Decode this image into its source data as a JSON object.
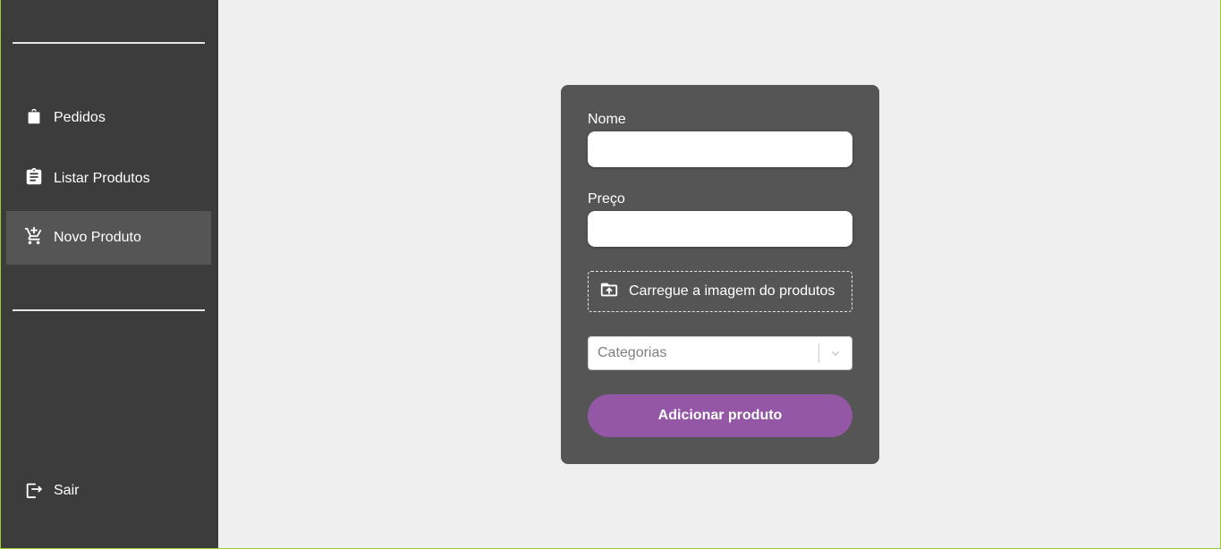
{
  "sidebar": {
    "items": [
      {
        "label": "Pedidos",
        "icon": "shopping-bag-icon"
      },
      {
        "label": "Listar Produtos",
        "icon": "clipboard-list-icon"
      },
      {
        "label": "Novo Produto",
        "icon": "cart-add-icon",
        "active": true
      }
    ],
    "logout": {
      "label": "Sair",
      "icon": "logout-icon"
    }
  },
  "form": {
    "name_label": "Nome",
    "name_value": "",
    "price_label": "Preço",
    "price_value": "",
    "upload_label": "Carregue a imagem do produtos",
    "category_placeholder": "Categorias",
    "submit_label": "Adicionar produto"
  },
  "colors": {
    "sidebar_bg": "#3c3c3c",
    "active_item_bg": "#555555",
    "card_bg": "#555555",
    "page_bg": "#efefef",
    "accent": "#9457a6"
  }
}
